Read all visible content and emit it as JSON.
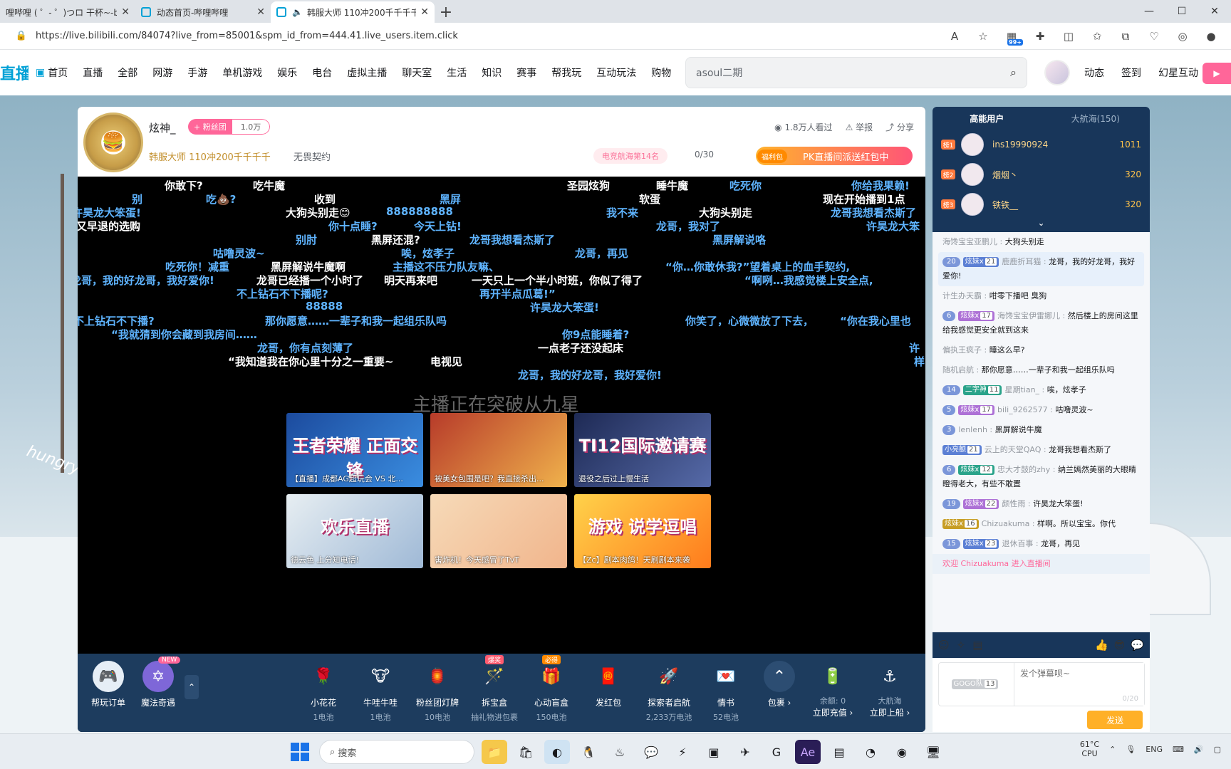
{
  "browser": {
    "tabs": [
      {
        "title": "哩哔哩 ( ゜- ゜)つロ 干杯~-bilibi",
        "active": false
      },
      {
        "title": "动态首页-哔哩哔哩",
        "active": false
      },
      {
        "title": "韩服大师 110冲200千千千千",
        "active": true
      }
    ],
    "new_tab": "+",
    "url": "https://live.bilibili.com/84074?live_from=85001&spm_id_from=444.41.live_users.item.click",
    "badge": "99+"
  },
  "site_nav": {
    "logo": "直播",
    "items": [
      "首页",
      "直播",
      "全部",
      "网游",
      "手游",
      "单机游戏",
      "娱乐",
      "电台",
      "虚拟主播",
      "聊天室",
      "生活",
      "知识",
      "赛事",
      "帮我玩",
      "互动玩法",
      "购物"
    ],
    "search_value": "asoul二期",
    "right_links": [
      "动态",
      "签到",
      "幻星互动"
    ]
  },
  "room": {
    "anchor_name": "炫神_",
    "follow_label": "+ 粉丝团",
    "fans_count": "1.0万",
    "title": "韩服大师 110冲200千千千千",
    "tag": "无畏契约",
    "viewers": "1.8万人看过",
    "report": "举报",
    "share": "分享",
    "rank": "电竞航海第14名",
    "pk_count": "0/30",
    "pk_tag": "福利包",
    "pk_text": "PK直播间派送红包中",
    "watermark": "主播正在突破从九星"
  },
  "danmaku": [
    {
      "text": "你敢下?",
      "color": "w"
    },
    {
      "text": "吃牛魔",
      "color": "w"
    },
    {
      "text": "圣园炫狗",
      "color": "w"
    },
    {
      "text": "睡牛魔",
      "color": "w"
    },
    {
      "text": "吃死你",
      "color": "b"
    },
    {
      "text": "你给我果赖!",
      "color": "b"
    },
    {
      "text": "别",
      "color": "b"
    },
    {
      "text": "吃💩?",
      "color": "b"
    },
    {
      "text": "收到",
      "color": "w"
    },
    {
      "text": "黑屏",
      "color": "b"
    },
    {
      "text": "软蛋",
      "color": "w"
    },
    {
      "text": "现在开始播到1点",
      "color": "w"
    },
    {
      "text": "许昊龙大笨蛋!",
      "color": "b"
    },
    {
      "text": "大狗头别走😊",
      "color": "w"
    },
    {
      "text": "888888888",
      "color": "b"
    },
    {
      "text": "我不来",
      "color": "b"
    },
    {
      "text": "大狗头别走",
      "color": "w"
    },
    {
      "text": "龙哥我想看杰斯了",
      "color": "b"
    },
    {
      "text": "又早退的选购",
      "color": "w"
    },
    {
      "text": "你十点睡?",
      "color": "b"
    },
    {
      "text": "今天上钻!",
      "color": "b"
    },
    {
      "text": "龙哥，我对了",
      "color": "b"
    },
    {
      "text": "许昊龙大笨",
      "color": "b"
    },
    {
      "text": "别肘",
      "color": "b"
    },
    {
      "text": "黑屏还混?",
      "color": "w"
    },
    {
      "text": "龙哥我想看杰斯了",
      "color": "b"
    },
    {
      "text": "黑屏解说咯",
      "color": "b"
    },
    {
      "text": "咕噜灵波~",
      "color": "b"
    },
    {
      "text": "唉，炫孝子",
      "color": "b"
    },
    {
      "text": "龙哥，再见",
      "color": "b"
    },
    {
      "text": "吃死你！减重",
      "color": "b"
    },
    {
      "text": "黑屏解说牛魔啊",
      "color": "w"
    },
    {
      "text": "主播这不压力队友嘛、",
      "color": "b"
    },
    {
      "text": "“你…你敢休我?”望着桌上的血手契约,",
      "color": "b"
    },
    {
      "text": "龙哥，我的好龙哥，我好爱你!",
      "color": "b"
    },
    {
      "text": "龙哥已经播一个小时了",
      "color": "w"
    },
    {
      "text": "明天再来吧",
      "color": "w"
    },
    {
      "text": "一天只上一个半小时班，你似了得了",
      "color": "w"
    },
    {
      "text": "“啊咧…我感觉楼上安全点,",
      "color": "b"
    },
    {
      "text": "不上钻石不下播呢?",
      "color": "b"
    },
    {
      "text": "再开半点瓜葛!”",
      "color": "b"
    },
    {
      "text": "88888",
      "color": "b"
    },
    {
      "text": "许昊龙大笨蛋!",
      "color": "b"
    },
    {
      "text": "不上钻石不下播?",
      "color": "b"
    },
    {
      "text": "那你愿意……一辈子和我一起组乐队吗",
      "color": "b"
    },
    {
      "text": "你笑了，心微微放了下去，",
      "color": "b"
    },
    {
      "text": "“你在我心里也",
      "color": "b"
    },
    {
      "text": "“我就猜到你会藏到我房间……",
      "color": "b"
    },
    {
      "text": "你9点能睡着?",
      "color": "b"
    },
    {
      "text": "龙哥，你有点刻薄了",
      "color": "b"
    },
    {
      "text": "一点老子还没起床",
      "color": "w"
    },
    {
      "text": "许",
      "color": "b"
    },
    {
      "text": "“我知道我在你心里十分之一重要~",
      "color": "w"
    },
    {
      "text": "电视见",
      "color": "w"
    },
    {
      "text": "龙哥，我的好龙哥，我好爱你!",
      "color": "b"
    },
    {
      "text": "样",
      "color": "b"
    }
  ],
  "recommend": [
    {
      "caption": "【直播】成都AG超玩会 VS 北...",
      "big": "王者荣耀 正面交锋"
    },
    {
      "caption": "被美女包围是吧？我直接杀出...",
      "big": ""
    },
    {
      "caption": "退役之后过上慢生活",
      "big": "TI12国际邀请赛"
    },
    {
      "caption": "德云色 上分知电话!",
      "big": "欢乐直播"
    },
    {
      "caption": "害炸机！今天感冒了TvT",
      "big": ""
    },
    {
      "caption": "【Zc】剧本肉鸽！天刷剧本来袭",
      "big": "游戏 说学逗唱"
    }
  ],
  "gift_bar": {
    "left": [
      {
        "name": "帮玩订单",
        "price": ""
      },
      {
        "name": "魔法奇遇",
        "price": "",
        "tag": "NEW"
      }
    ],
    "gifts": [
      {
        "name": "小花花",
        "price": "1电池",
        "tag": ""
      },
      {
        "name": "牛哇牛哇",
        "price": "1电池",
        "tag": ""
      },
      {
        "name": "粉丝团灯牌",
        "price": "10电池",
        "tag": ""
      },
      {
        "name": "拆宝盒",
        "price": "抽礼物进包裹",
        "tag": "爆奖"
      },
      {
        "name": "心动盲盒",
        "price": "150电池",
        "tag": "必得"
      },
      {
        "name": "发红包",
        "price": "",
        "tag": ""
      },
      {
        "name": "探索者启航",
        "price": "2,233万电池",
        "tag": ""
      },
      {
        "name": "情书",
        "price": "52电池",
        "tag": ""
      }
    ],
    "package": "包裹 ›",
    "balance_label": "余额: 0",
    "recharge": "立即充值 ›",
    "guard_name": "大航海",
    "guard_action": "立即上船 ›"
  },
  "rank_panel": {
    "tab_active": "高能用户",
    "tab_other": "大航海(150)",
    "rows": [
      {
        "rank": "榜1",
        "name": "ins19990924",
        "score": "1011"
      },
      {
        "rank": "榜2",
        "name": "烟烟丶",
        "score": "320"
      },
      {
        "rank": "榜3",
        "name": "铁铁__",
        "score": "320"
      }
    ]
  },
  "chat": [
    {
      "user": "海馋宝宝亚鹏儿",
      "msg": "大狗头别走",
      "lv": "",
      "medal": "",
      "medal_lv": "",
      "hl": false
    },
    {
      "user": "鹿鹿折耳猫",
      "msg": "龙哥，我的好龙哥，我好爱你!",
      "lv": "20",
      "medal": "炫妹x",
      "medal_lv": "21",
      "hl": true
    },
    {
      "user": "计生办天霸",
      "msg": "咁零下播吧 臭狗",
      "lv": "",
      "medal": "",
      "medal_lv": "",
      "hl": false
    },
    {
      "user": "海馋宝宝伊雷娜儿",
      "msg": "然后楼上的房间这里给我感觉更安全就到这来",
      "lv": "6",
      "medal": "炫妹x",
      "medal_lv": "17",
      "hl": false
    },
    {
      "user": "偏执王疯子",
      "msg": "睡这么早?",
      "lv": "",
      "medal": "",
      "medal_lv": "",
      "hl": false
    },
    {
      "user": "随机启航",
      "msg": "那你愿意……一辈子和我一起组乐队吗",
      "lv": "",
      "medal": "",
      "medal_lv": "",
      "hl": false
    },
    {
      "user": "星期tian_",
      "msg": "唉，炫孝子",
      "lv": "14",
      "medal": "二字神",
      "medal_lv": "11",
      "hl": false
    },
    {
      "user": "bili_9262577",
      "msg": "咕噜灵波~",
      "lv": "5",
      "medal": "炫妹x",
      "medal_lv": "17",
      "hl": false
    },
    {
      "user": "lenlenh",
      "msg": "黑屏解说牛魔",
      "lv": "3",
      "medal": "",
      "medal_lv": "",
      "hl": false
    },
    {
      "user": "云上的天堂QAQ",
      "msg": "龙哥我想看杰斯了",
      "lv": "",
      "medal": "小亮额",
      "medal_lv": "21",
      "hl": false
    },
    {
      "user": "忠大才鼓的zhy",
      "msg": "纳兰嫣然美丽的大眼睛瞪得老大，有些不敢置",
      "lv": "6",
      "medal": "炫妹x",
      "medal_lv": "12",
      "hl": false
    },
    {
      "user": "颜性雨",
      "msg": "许昊龙大笨蛋!",
      "lv": "19",
      "medal": "炫妹x",
      "medal_lv": "22",
      "hl": false
    },
    {
      "user": "Chizuakuma",
      "msg": "样啊。所以宝宝。你代",
      "lv": "",
      "medal": "炫妹x",
      "medal_lv": "16",
      "hl": false
    },
    {
      "user": "退休百事",
      "msg": "龙哥，再见",
      "lv": "15",
      "medal": "炫妹x",
      "medal_lv": "23",
      "hl": false
    }
  ],
  "chat_overlay": "欢迎 Chizuakuma 进入直播间",
  "input": {
    "medal_sel": "GOGO队",
    "medal_sel_lv": "13",
    "placeholder": "发个弹幕呗~",
    "count": "0/20",
    "send": "发送"
  },
  "taskbar": {
    "search_placeholder": "搜索",
    "temp": "61°C",
    "temp_label": "CPU",
    "lang": "ENG"
  },
  "scene": {
    "hungry": "hungry"
  },
  "colors": {
    "accent": "#00a1d6",
    "pink": "#ff6699",
    "gold": "#ffb027",
    "panel": "#18365a"
  }
}
